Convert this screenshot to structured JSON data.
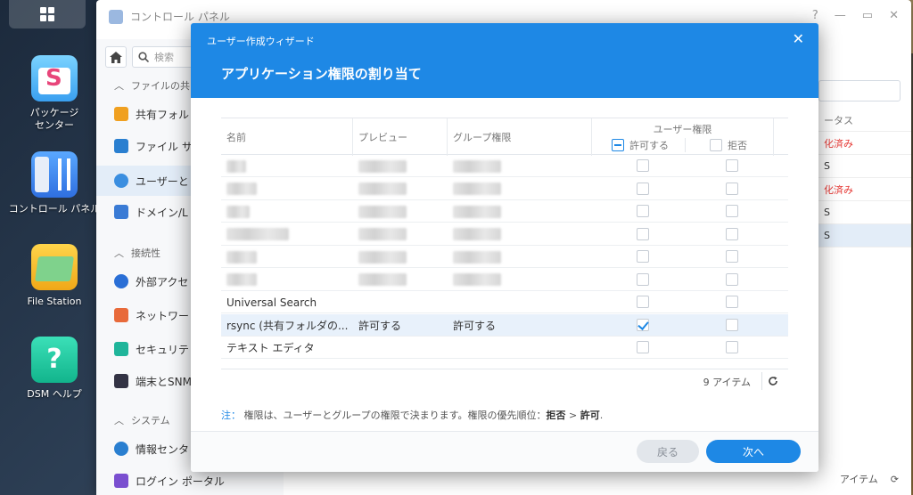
{
  "desktop": {
    "icons": [
      {
        "label": "パッケージ\nセンター",
        "icon": "package-center-icon"
      },
      {
        "label": "コントロール パネル",
        "icon": "control-panel-icon"
      },
      {
        "label": "File Station",
        "icon": "file-station-icon"
      },
      {
        "label": "DSM ヘルプ",
        "icon": "help-icon"
      }
    ]
  },
  "control_panel": {
    "title": "コントロール パネル",
    "search_placeholder": "検索",
    "nav": {
      "group_file": "ファイルの共",
      "shared_folder": "共有フォル",
      "file_services": "ファイル サ",
      "user_group": "ユーザーと",
      "domain": "ドメイン/L",
      "group_connectivity": "接続性",
      "external_access": "外部アクセ",
      "network": "ネットワー",
      "security": "セキュリテ",
      "terminal": "端末とSNM",
      "group_system": "システム",
      "info_center": "情報センタ",
      "login_portal": "ログイン ポータル"
    },
    "right_col": {
      "status_header": "ータス",
      "row1": "化済み",
      "row2": "S",
      "row3": "化済み",
      "row4": "S",
      "row5": "S"
    },
    "footer_count": "アイテム"
  },
  "dialog": {
    "wizard_title": "ユーザー作成ウィザード",
    "heading": "アプリケーション権限の割り当て",
    "columns": {
      "name": "名前",
      "preview": "プレビュー",
      "group_permission": "グループ権限",
      "user_permission": "ユーザー権限",
      "allow": "許可する",
      "deny": "拒否"
    },
    "rows": [
      {
        "name": "",
        "preview": "",
        "group": "",
        "allow": false,
        "deny": false,
        "redacted": true
      },
      {
        "name": "",
        "preview": "",
        "group": "",
        "allow": false,
        "deny": false,
        "redacted": true
      },
      {
        "name": "",
        "preview": "",
        "group": "",
        "allow": false,
        "deny": false,
        "redacted": true
      },
      {
        "name": "",
        "preview": "",
        "group": "",
        "allow": false,
        "deny": false,
        "redacted": true
      },
      {
        "name": "",
        "preview": "",
        "group": "",
        "allow": false,
        "deny": false,
        "redacted": true
      },
      {
        "name": "",
        "preview": "",
        "group": "",
        "allow": false,
        "deny": false,
        "redacted": true
      },
      {
        "name": "Universal Search",
        "preview": "",
        "group": "",
        "allow": false,
        "deny": false,
        "redacted": false
      },
      {
        "name": "rsync (共有フォルダの...",
        "preview": "許可する",
        "group": "許可する",
        "allow": true,
        "deny": false,
        "redacted": false,
        "selected": true
      },
      {
        "name": "テキスト エディタ",
        "preview": "",
        "group": "",
        "allow": false,
        "deny": false,
        "redacted": false
      }
    ],
    "item_count": "9 アイテム",
    "note": {
      "prefix": "注：",
      "text": "権限は、ユーザーとグループの権限で決まります。権限の優先順位：",
      "deny": "拒否",
      "gt": " > ",
      "allow": "許可",
      "end": "."
    },
    "back_label": "戻る",
    "next_label": "次へ"
  },
  "colors": {
    "accent": "#1e88e5",
    "danger": "#e53935"
  }
}
